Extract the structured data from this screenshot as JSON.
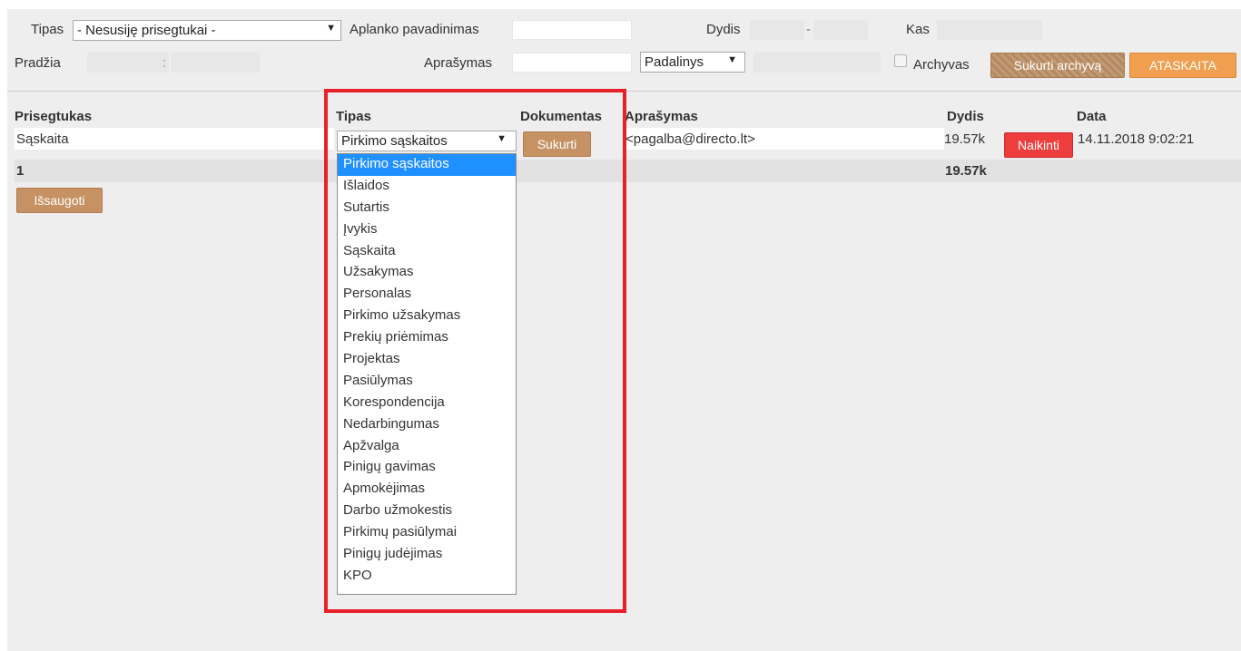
{
  "filter": {
    "tipas_label": "Tipas",
    "tipas_value": "- Nesusiję prisegtukai -",
    "aplanko_label": "Aplanko pavadinimas",
    "aplanko_value": "",
    "dydis_label": "Dydis",
    "dydis_sep": "-",
    "kas_label": "Kas",
    "pradzia_label": "Pradžia",
    "pradzia_sep": ":",
    "aprasymas_label": "Aprašymas",
    "aprasymas_value": "",
    "padalinys_value": "Padalinys",
    "archyvas_label": "Archyvas",
    "sukurti_archyva_label": "Sukurti archyvą",
    "ataskaita_label": "ATASKAITA"
  },
  "table": {
    "headers": {
      "prisegtukas": "Prisegtukas",
      "tipas": "Tipas",
      "dokumentas": "Dokumentas",
      "aprasymas": "Aprašymas",
      "dydis": "Dydis",
      "data": "Data"
    },
    "row": {
      "prisegtukas": "Sąskaita",
      "tipas": "Pirkimo sąskaitos",
      "sukurti_label": "Sukurti",
      "aprasymas": "<pagalba@directo.lt>",
      "dydis": "19.57k",
      "naikinti_label": "Naikinti",
      "data": "14.11.2018 9:02:21"
    },
    "totals": {
      "count": "1",
      "dydis": "19.57k"
    },
    "issaugoti_label": "Išsaugoti"
  },
  "dropdown": {
    "selected_index": 0,
    "options": [
      "Pirkimo sąskaitos",
      "Išlaidos",
      "Sutartis",
      "Įvykis",
      "Sąskaita",
      "Užsakymas",
      "Personalas",
      "Pirkimo užsakymas",
      "Prekių priėmimas",
      "Projektas",
      "Pasiūlymas",
      "Korespondencija",
      "Nedarbingumas",
      "Apžvalga",
      "Pinigų gavimas",
      "Apmokėjimas",
      "Darbo užmokestis",
      "Pirkimų pasiūlymai",
      "Pinigų judėjimas",
      "KPO"
    ]
  },
  "colors": {
    "highlight": "#e8202a",
    "selected_option": "#1e90ff",
    "delete_button": "#ee3d3d"
  }
}
